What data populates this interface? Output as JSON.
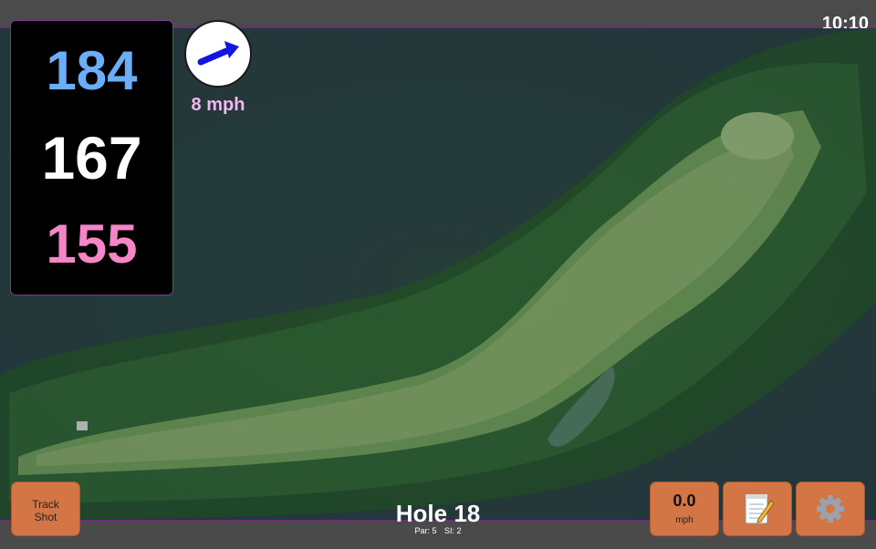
{
  "status_bar": {
    "time": "10:10"
  },
  "distances": {
    "back": "184",
    "center": "167",
    "front": "155"
  },
  "wind": {
    "speed_label": "8 mph",
    "direction_icon": "arrow-icon"
  },
  "hole": {
    "title": "Hole 18",
    "par": "Par: 5",
    "stroke_index": "SI: 2"
  },
  "buttons": {
    "track_shot_line1": "Track",
    "track_shot_line2": "Shot",
    "wind_value": "0.0",
    "wind_unit": "mph",
    "notes_icon": "notepad-icon",
    "settings_icon": "gear-icon"
  },
  "colors": {
    "back_distance": "#6aaef7",
    "center_distance": "#ffffff",
    "front_distance": "#f585c6",
    "button": "#d37545",
    "accent_border": "#6a2f78"
  }
}
